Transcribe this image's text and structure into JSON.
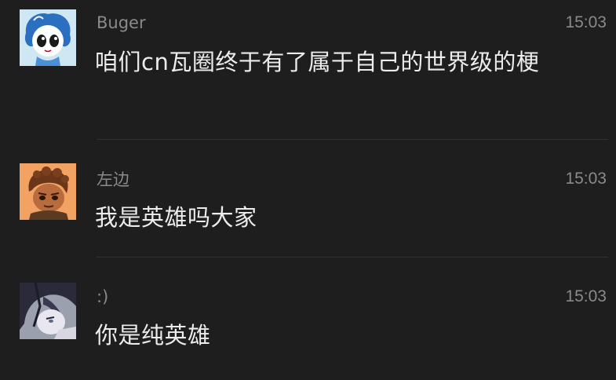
{
  "messages": [
    {
      "sender": "Buger",
      "time": "15:03",
      "text": "咱们cn瓦圈终于有了属于自己的世界级的梗",
      "avatar": "cartoon-girl-blue-hair-avatar"
    },
    {
      "sender": "左边",
      "time": "15:03",
      "text": "我是英雄吗大家",
      "avatar": "cartoon-boy-brown-hair-avatar"
    },
    {
      "sender": ":)",
      "time": "15:03",
      "text": "你是纯英雄",
      "avatar": "anime-dark-hair-avatar"
    }
  ],
  "colors": {
    "background": "#1e1e1e",
    "meta_text": "#8a8a8a",
    "message_text": "#ececec",
    "divider": "#313131"
  }
}
